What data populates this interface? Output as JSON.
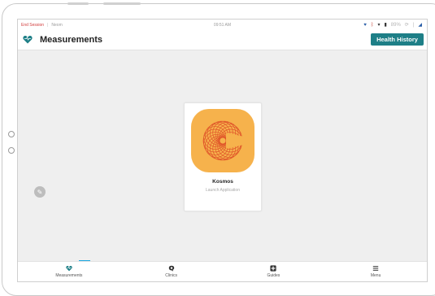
{
  "status_bar": {
    "end_session": "End Session",
    "separator": "|",
    "secondary": "Neom",
    "time": "09:51 AM",
    "battery": "89%"
  },
  "app_bar": {
    "title": "Measurements",
    "health_history_label": "Health History"
  },
  "app_card": {
    "name": "Kosmos",
    "subtitle": "Launch Application",
    "icon": "kosmos-spiral-icon"
  },
  "badge": {
    "label": "H"
  },
  "bottom_nav": {
    "items": [
      {
        "label": "Measurements",
        "icon": "heart-icon",
        "active": true
      },
      {
        "label": "Clinics",
        "icon": "chat-bubble-icon",
        "active": false
      },
      {
        "label": "Guides",
        "icon": "plus-square-icon",
        "active": false
      },
      {
        "label": "Menu",
        "icon": "menu-icon",
        "active": false
      }
    ]
  },
  "colors": {
    "accent": "#1e7f87",
    "icon_bg": "#f6b24c",
    "spiral": "#e0562a",
    "badge": "#1aa6e0",
    "end_session": "#d23c3c"
  }
}
